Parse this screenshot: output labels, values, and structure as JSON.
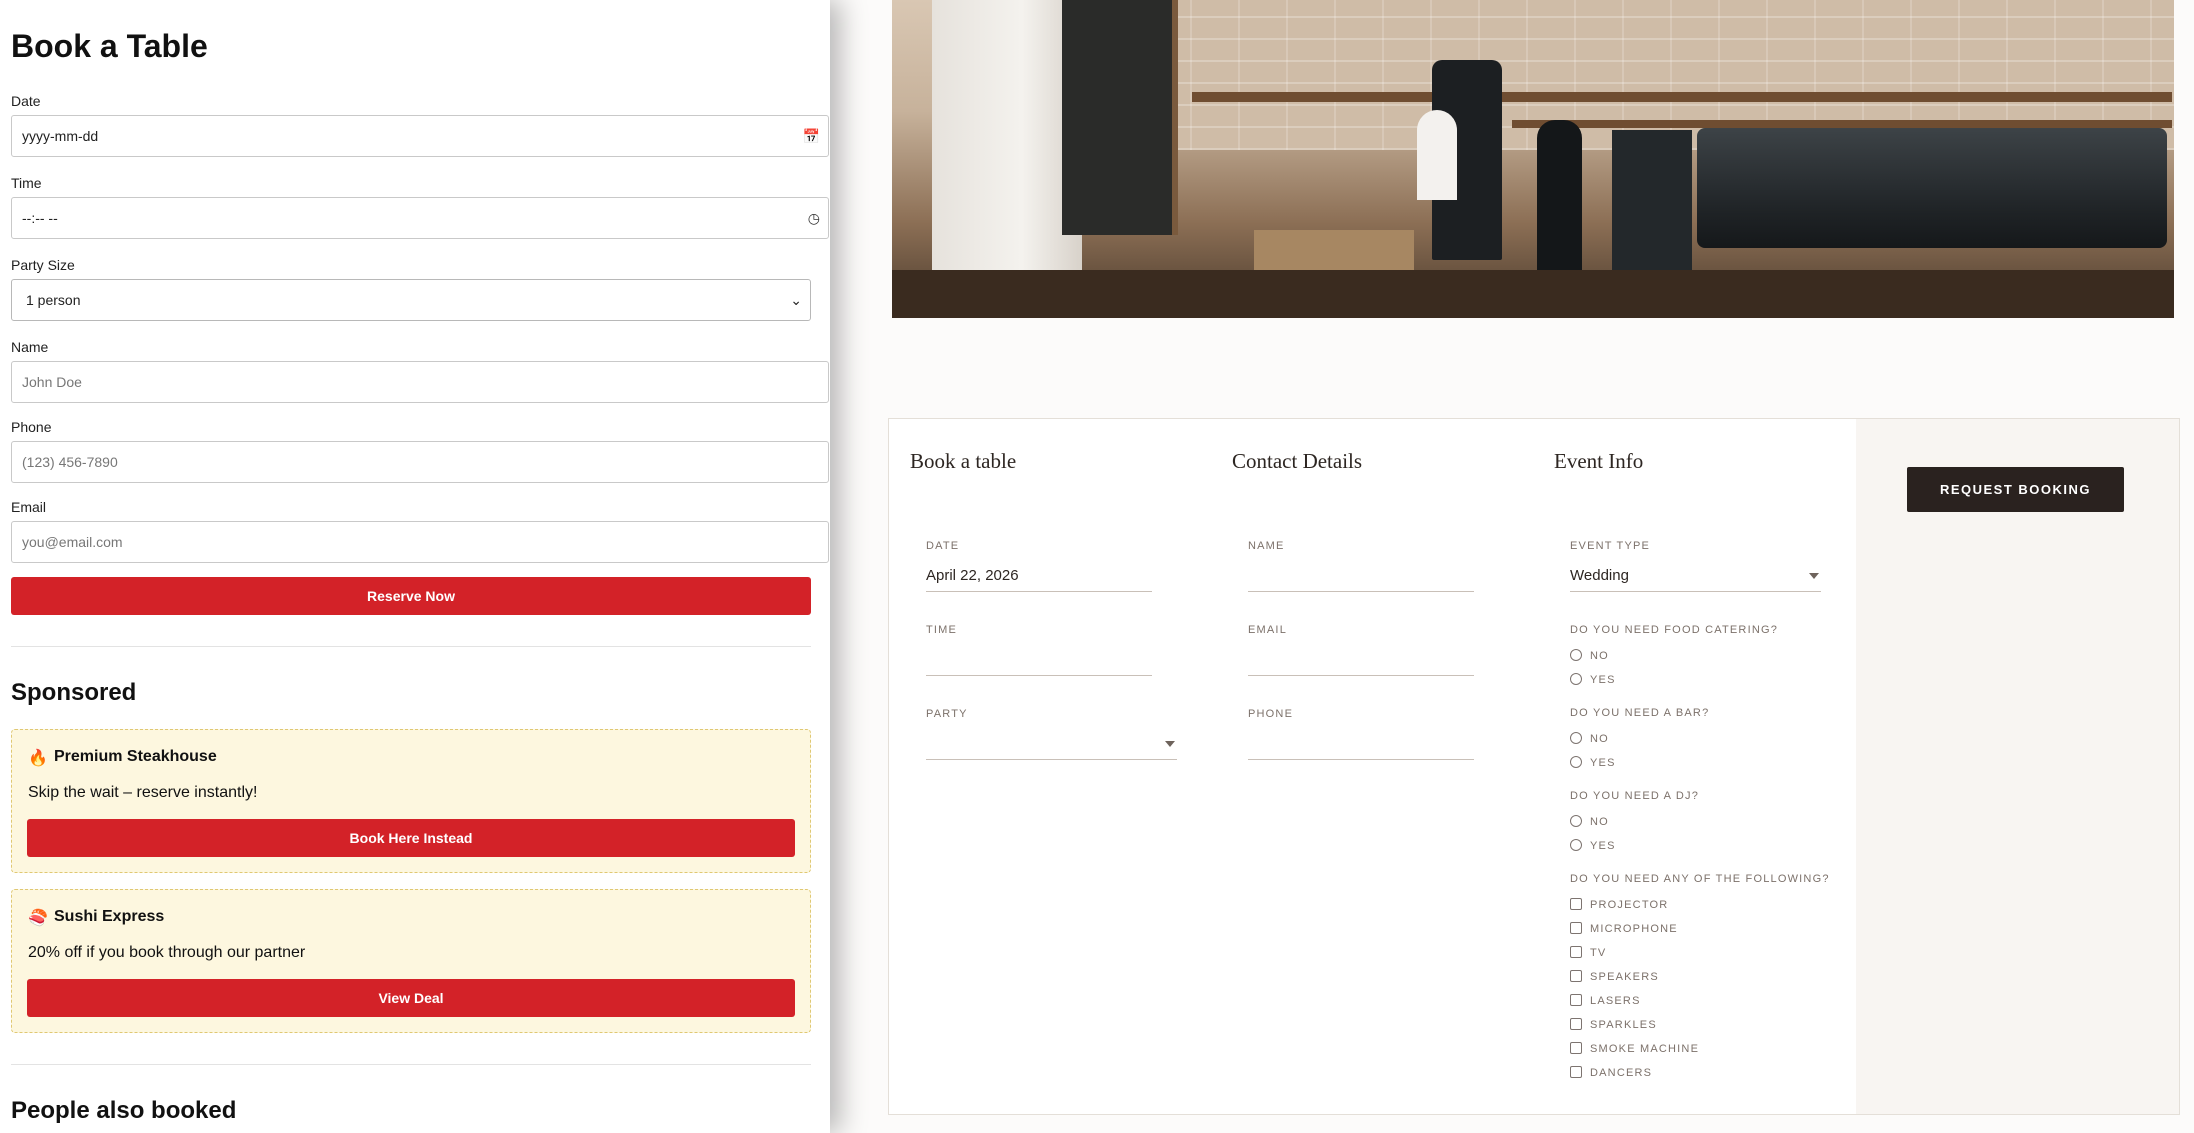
{
  "overlay": {
    "title": "Book a Table",
    "date": {
      "label": "Date",
      "value": "yyyy-mm-dd",
      "icon": "calendar-icon"
    },
    "time": {
      "label": "Time",
      "value": "--:-- --",
      "icon": "clock-icon"
    },
    "party": {
      "label": "Party Size",
      "value": "1 person"
    },
    "name": {
      "label": "Name",
      "placeholder": "John Doe"
    },
    "phone": {
      "label": "Phone",
      "placeholder": "(123) 456-7890"
    },
    "email": {
      "label": "Email",
      "placeholder": "you@email.com"
    },
    "reserve_label": "Reserve Now",
    "sponsored": {
      "heading": "Sponsored",
      "ads": [
        {
          "icon": "🔥",
          "name": "Premium Steakhouse",
          "text": "Skip the wait – reserve instantly!",
          "button": "Book Here Instead"
        },
        {
          "icon": "🍣",
          "name": "Sushi Express",
          "text": "20% off if you book through our partner",
          "button": "View Deal"
        }
      ]
    },
    "also_booked_heading": "People also booked"
  },
  "booking": {
    "col1_title": "Book a table",
    "col2_title": "Contact Details",
    "col3_title": "Event Info",
    "request_label": "REQUEST BOOKING",
    "date_label": "DATE",
    "date_value": "April 22, 2026",
    "time_label": "TIME",
    "time_value": "",
    "party_label": "PARTY",
    "party_value": "",
    "name_label": "NAME",
    "email_label": "EMAIL",
    "phone_label": "PHONE",
    "event_type_label": "EVENT TYPE",
    "event_type_value": "Wedding",
    "catering_q": "DO YOU NEED FOOD CATERING?",
    "bar_q": "DO YOU NEED A BAR?",
    "dj_q": "DO YOU NEED A DJ?",
    "no": "NO",
    "yes": "YES",
    "following_q": "DO YOU NEED ANY OF THE FOLLOWING?",
    "equipment": [
      "PROJECTOR",
      "MICROPHONE",
      "TV",
      "SPEAKERS",
      "LASERS",
      "SPARKLES",
      "SMOKE MACHINE",
      "DANCERS"
    ]
  },
  "colors": {
    "accent_red": "#d32228",
    "dark_button": "#2a221f",
    "ad_background": "#fdf7df"
  }
}
